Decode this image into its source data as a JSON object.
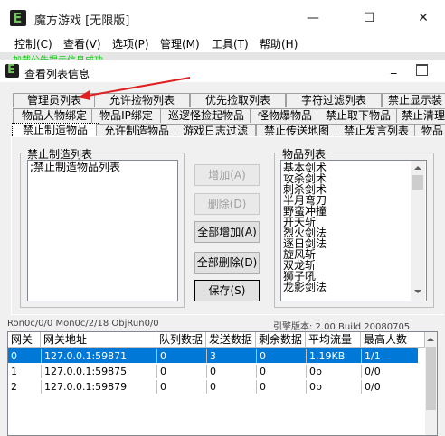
{
  "main": {
    "title": "魔方游戏 [无限版]",
    "window_buttons": {
      "minimize": "—",
      "maximize": "☐",
      "close": "✕"
    },
    "menu": [
      "控制(C)",
      "查看(V)",
      "选项(P)",
      "管理(M)",
      "工具(T)",
      "帮助(H)"
    ],
    "notice": "加载公告提示信息成功"
  },
  "dialog": {
    "title": "查看列表信息",
    "window_buttons": {
      "minimize": "_"
    },
    "tabs_row1": [
      "管理员列表",
      "允许捡物列表",
      "优先捡取列表",
      "字符过滤列表",
      "禁止显示装"
    ],
    "tabs_row2": [
      "物品人物绑定",
      "物品IP绑定",
      "巡逻怪捡起物品",
      "怪物爆物品",
      "禁止取下物品",
      "禁止清理"
    ],
    "tabs_row3": [
      "禁止制造物品",
      "允许制造物品",
      "游戏日志过滤",
      "禁止传送地图",
      "禁止发言列表",
      "物品"
    ],
    "active_tab": "禁止制造物品",
    "left_group": {
      "label": "禁止制造列表",
      "items": [
        ";禁止制造物品列表"
      ]
    },
    "buttons": {
      "add": "增加(A)",
      "delete": "删除(D)",
      "add_all": "全部增加(A)",
      "delete_all": "全部删除(D)",
      "save": "保存(S)"
    },
    "right_group": {
      "label": "物品列表",
      "items": [
        "基本剑术",
        "攻杀剑术",
        "刺杀剑术",
        "半月弯刀",
        "野蛮冲撞",
        "开天斩",
        "烈火剑法",
        "逐日剑法",
        "旋风斩",
        "双龙斩",
        "狮子吼",
        "龙影剑法"
      ]
    }
  },
  "status": {
    "left": "Ron0c/0/0  Mon0c/2/18  ObjRun0/0",
    "right": "引擎版本: 2.00 Build 20080705"
  },
  "gateway_table": {
    "columns": [
      "网关",
      "网关地址",
      "队列数据",
      "发送数据",
      "剩余数据",
      "平均流量",
      "最高人数"
    ],
    "rows": [
      [
        "0",
        "127.0.0.1:59871",
        "0",
        "3",
        "0",
        "1.19KB",
        "1/1"
      ],
      [
        "1",
        "127.0.0.1:59875",
        "0",
        "0",
        "0",
        "0b",
        "0/0"
      ],
      [
        "2",
        "127.0.0.1:59879",
        "0",
        "0",
        "0",
        "0b",
        "0/0"
      ]
    ],
    "selected_row": 0
  },
  "colors": {
    "selection": "#0078d7",
    "annotation_arrow": "#e02020",
    "notice_text": "#10c810",
    "icon_green": "#72c55a"
  }
}
